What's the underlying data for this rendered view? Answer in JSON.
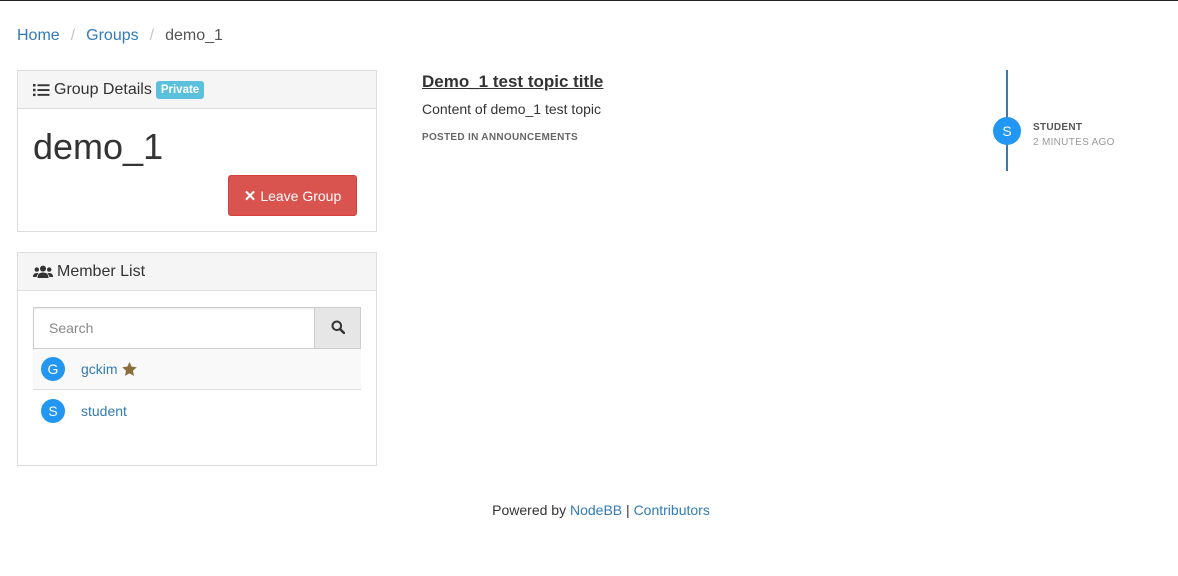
{
  "breadcrumb": {
    "items": [
      "Home",
      "Groups"
    ],
    "current": "demo_1"
  },
  "group_details": {
    "heading": "Group Details",
    "badge": "Private",
    "name": "demo_1",
    "leave_label": "Leave Group",
    "icon": "list-icon"
  },
  "member_list": {
    "heading": "Member List",
    "icon": "users-icon",
    "search_placeholder": "Search",
    "members": [
      {
        "initial": "G",
        "name": "gckim",
        "owner": true
      },
      {
        "initial": "S",
        "name": "student",
        "owner": false
      }
    ]
  },
  "topic": {
    "title": "Demo_1 test topic title",
    "content": "Content of demo_1 test topic",
    "posted_in": "POSTED IN ANNOUNCEMENTS"
  },
  "timeline": {
    "initial": "S",
    "user": "STUDENT",
    "time": "2 MINUTES AGO"
  },
  "footer": {
    "prefix": "Powered by",
    "link1": "NodeBB",
    "separator": "|",
    "link2": "Contributors"
  },
  "colors": {
    "link": "#337ab7",
    "danger": "#d9534f",
    "info": "#5bc0de",
    "avatar": "#2196f3"
  }
}
